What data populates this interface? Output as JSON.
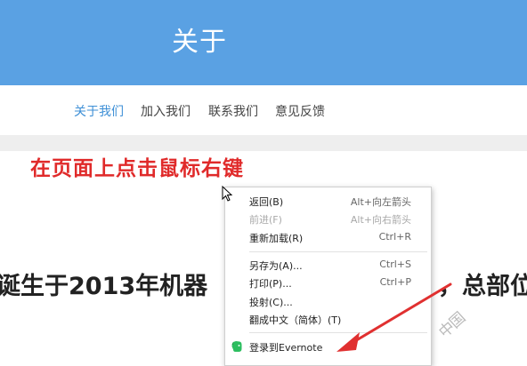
{
  "header": {
    "title": "关于"
  },
  "nav": {
    "items": [
      "关于我们",
      "加入我们",
      "联系我们",
      "意见反馈"
    ]
  },
  "annotation": "在页面上点击鼠标右键",
  "body": {
    "left_text": "诞生于2013年机器",
    "right_text": "，总部位"
  },
  "watermark": "中国",
  "context_menu": {
    "back": {
      "label": "返回(B)",
      "shortcut": "Alt+向左箭头"
    },
    "forward": {
      "label": "前进(F)",
      "shortcut": "Alt+向右箭头"
    },
    "reload": {
      "label": "重新加载(R)",
      "shortcut": "Ctrl+R"
    },
    "save_as": {
      "label": "另存为(A)...",
      "shortcut": "Ctrl+S"
    },
    "print": {
      "label": "打印(P)...",
      "shortcut": "Ctrl+P"
    },
    "cast": {
      "label": "投射(C)..."
    },
    "translate": {
      "label": "翻成中文（简体）(T)"
    },
    "evernote": {
      "label": "登录到Evernote"
    }
  },
  "colors": {
    "header_bg": "#5aa1e3",
    "nav_active": "#3d8fd6",
    "annotation": "#e02a2a",
    "arrow": "#e03030"
  }
}
